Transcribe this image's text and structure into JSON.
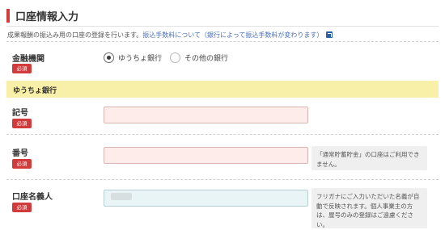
{
  "section": {
    "title": "口座情報入力",
    "description": "成果報酬の振込み用の口座の登録を行います。",
    "link_text": "振込手数料について（銀行によって振込手数料が変わります）"
  },
  "financial_institution": {
    "label": "金融機関",
    "required_badge": "必須",
    "options": [
      "ゆうちょ銀行",
      "その他の銀行"
    ],
    "selected": "ゆうちょ銀行"
  },
  "bank_section": {
    "title": "ゆうちょ銀行"
  },
  "symbol": {
    "label": "記号",
    "required_badge": "必須",
    "value": ""
  },
  "number": {
    "label": "番号",
    "required_badge": "必須",
    "value": "",
    "note": "「通常貯蓄貯金」の口座はご利用できません。"
  },
  "account_holder": {
    "label": "口座名義人",
    "required_badge": "必須",
    "note": "フリガナにご入力いただいた名義が自動で反映されます。個人事業主の方は、屋号のみの登録はご遠慮ください。"
  },
  "colors": {
    "accent": "#d43c3c",
    "badge": "#d13b3b",
    "link": "#4a6fb5",
    "band": "#f8efa8",
    "input_required": "#fdecea",
    "input_autofill": "#e9f4f6"
  }
}
